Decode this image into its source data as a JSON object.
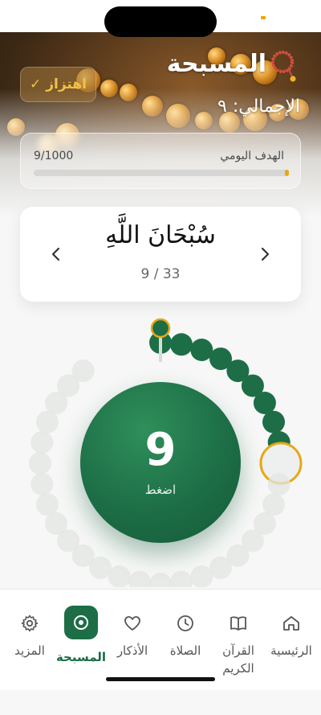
{
  "status": {
    "indicator_color": "#f0a500"
  },
  "header": {
    "title": "المسبحة",
    "icon": "prayer-beads-icon",
    "total_text": "الإجمالي: ٩",
    "vibrate_label": "اهتزاز ✓"
  },
  "goal": {
    "label": "الهدف اليومي",
    "value_text": "9/1000",
    "progress": 0.009
  },
  "dhikr": {
    "text": "سُبْحَانَ اللَّهِ",
    "count_text": "9 / 33",
    "prev_icon": "chevron-left-icon",
    "next_icon": "chevron-right-icon"
  },
  "counter": {
    "value": "9",
    "hint": "اضغط",
    "beads_total": 33,
    "beads_done": 9
  },
  "colors": {
    "primary": "#1d6e46",
    "accent": "#e6a817",
    "bead_empty": "#e1e6e2"
  },
  "tabs": [
    {
      "label": "الرئيسية",
      "icon": "home-icon",
      "active": false
    },
    {
      "label": "القرآن الكريم",
      "icon": "book-icon",
      "active": false
    },
    {
      "label": "الصلاة",
      "icon": "clock-icon",
      "active": false
    },
    {
      "label": "الأذكار",
      "icon": "heart-icon",
      "active": false
    },
    {
      "label": "المسبحة",
      "icon": "tasbih-target-icon",
      "active": true
    },
    {
      "label": "المزيد",
      "icon": "gear-icon",
      "active": false
    }
  ]
}
